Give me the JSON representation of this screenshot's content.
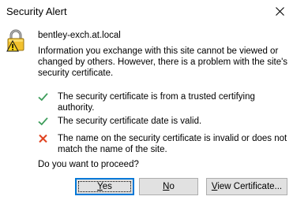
{
  "window": {
    "title": "Security Alert",
    "close_icon": "close-icon"
  },
  "alert": {
    "icon": "lock-warning-icon",
    "host": "bentley-exch.at.local",
    "info_text": "Information you exchange with this site cannot be viewed or changed by others. However, there is a problem with the site's security certificate.",
    "checks": [
      {
        "status": "ok",
        "icon": "check-icon",
        "color": "#3c9c5a",
        "text": "The security certificate is from a trusted certifying authority."
      },
      {
        "status": "ok",
        "icon": "check-icon",
        "color": "#3c9c5a",
        "text": "The security certificate date is valid."
      },
      {
        "status": "error",
        "icon": "cross-icon",
        "color": "#e0421f",
        "text": "The name on the security certificate is invalid or does not match the name of the site."
      }
    ],
    "question": "Do you want to proceed?"
  },
  "buttons": {
    "yes_mnemonic": "Y",
    "yes_rest": "es",
    "no_mnemonic": "N",
    "no_rest": "o",
    "view_mnemonic": "V",
    "view_rest": "iew Certificate..."
  }
}
